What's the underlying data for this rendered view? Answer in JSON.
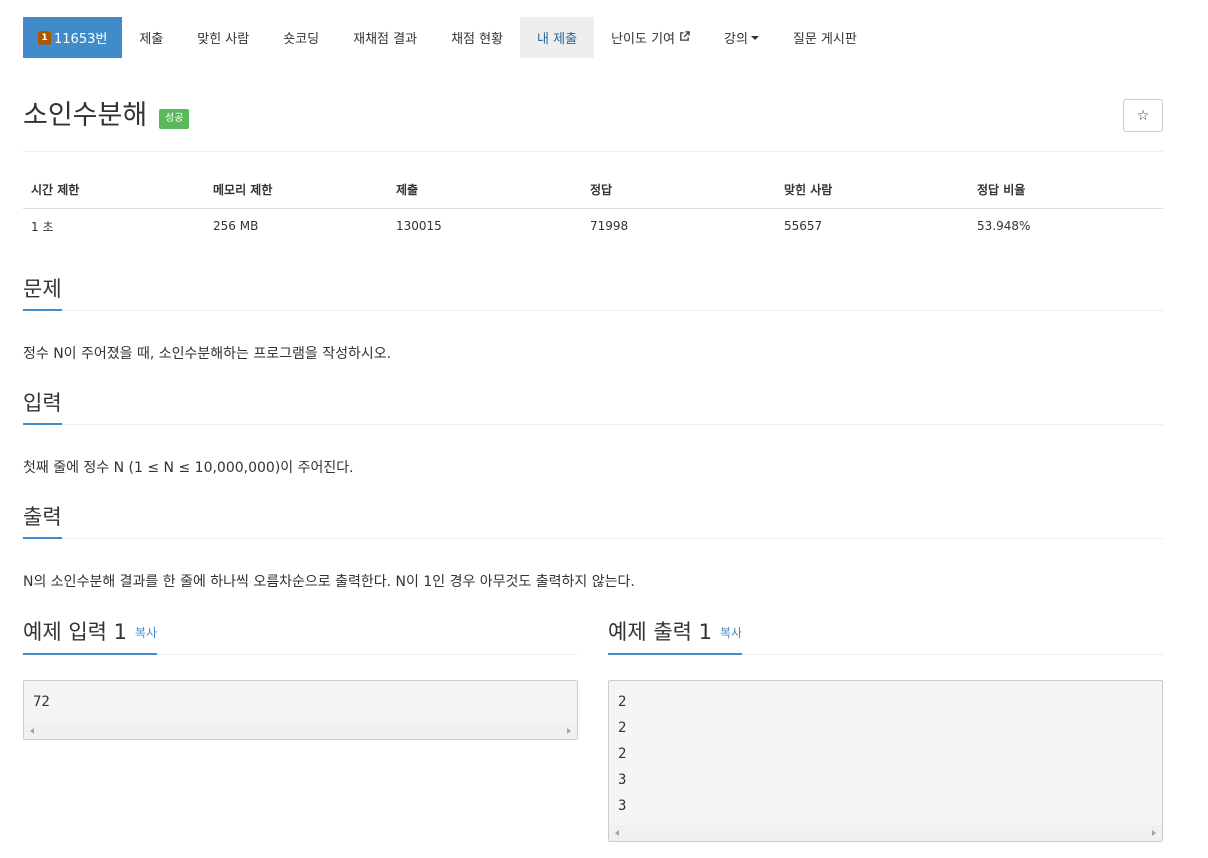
{
  "nav": {
    "problem_tier": "1",
    "problem_number": "11653번",
    "tabs": [
      {
        "label": "제출"
      },
      {
        "label": "맞힌 사람"
      },
      {
        "label": "숏코딩"
      },
      {
        "label": "재채점 결과"
      },
      {
        "label": "채점 현황"
      },
      {
        "label": "내 제출"
      },
      {
        "label": "난이도 기여"
      },
      {
        "label": "강의"
      },
      {
        "label": "질문 게시판"
      }
    ]
  },
  "problem": {
    "title": "소인수분해",
    "status_label": "성공",
    "star_icon": "☆"
  },
  "info_table": {
    "headers": [
      "시간 제한",
      "메모리 제한",
      "제출",
      "정답",
      "맞힌 사람",
      "정답 비율"
    ],
    "values": [
      "1 초",
      "256 MB",
      "130015",
      "71998",
      "55657",
      "53.948%"
    ]
  },
  "sections": {
    "description": {
      "heading": "문제",
      "text": "정수 N이 주어졌을 때, 소인수분해하는 프로그램을 작성하시오."
    },
    "input": {
      "heading": "입력",
      "text": "첫째 줄에 정수 N (1 ≤ N ≤ 10,000,000)이 주어진다."
    },
    "output": {
      "heading": "출력",
      "text": "N의 소인수분해 결과를 한 줄에 하나씩 오름차순으로 출력한다. N이 1인 경우 아무것도 출력하지 않는다."
    }
  },
  "samples": {
    "input": {
      "heading": "예제 입력 1",
      "copy_label": "복사",
      "content": "72"
    },
    "output": {
      "heading": "예제 출력 1",
      "copy_label": "복사",
      "content": "2\n2\n2\n3\n3"
    }
  },
  "colors": {
    "primary": "#428bca",
    "success": "#5cb85c",
    "tier_bronze": "#ad5600"
  }
}
